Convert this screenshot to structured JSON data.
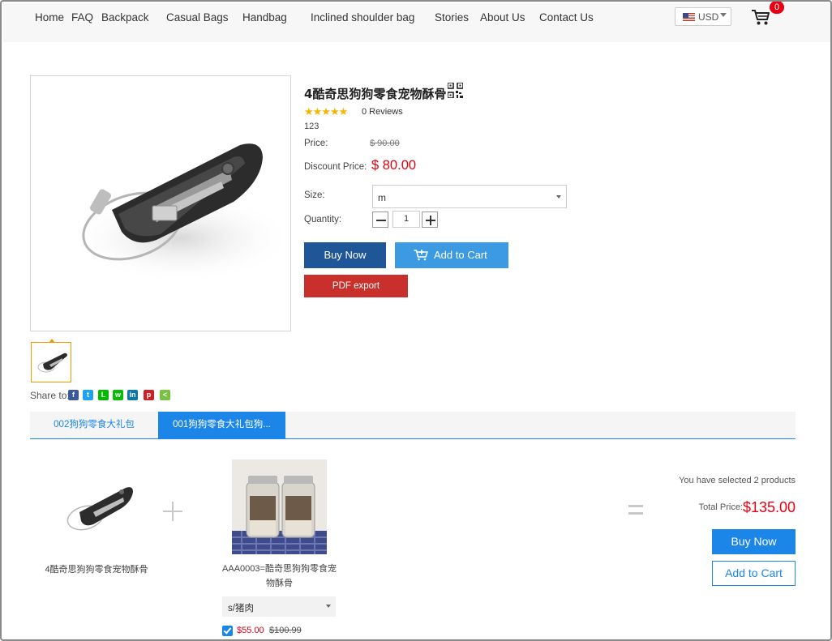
{
  "nav": {
    "items": [
      "Home",
      "FAQ",
      "Backpack",
      "Casual Bags",
      "Handbag",
      "Inclined shoulder bag",
      "Stories",
      "About Us",
      "Contact Us"
    ]
  },
  "currency": {
    "code": "USD",
    "flag": "us-flag-icon"
  },
  "cart": {
    "count": "0",
    "icon": "cart-icon"
  },
  "product": {
    "title": "4酷奇思狗狗零食宠物酥骨",
    "rating_stars": "★★★★★",
    "rating_value": 5,
    "reviews": "0 Reviews",
    "sku": "123",
    "price_label": "Price:",
    "price": "$ 90.00",
    "discount_label": "Discount Price:",
    "discount_price": "$ 80.00",
    "size_label": "Size:",
    "size_value": "m",
    "quantity_label": "Quantity:",
    "quantity": "1",
    "buy_now": "Buy Now",
    "add_to_cart": "Add to Cart",
    "pdf_export": "PDF export",
    "share_label": "Share to:",
    "share_icons": [
      "facebook-icon",
      "twitter-icon",
      "line-icon",
      "wechat-icon",
      "linkedin-icon",
      "pinterest-icon",
      "share-icon"
    ]
  },
  "tabs": [
    "002狗狗零食大礼包",
    "001狗狗零食大礼包狗..."
  ],
  "bundle": {
    "item1_name": "4酷奇思狗狗零食宠物酥骨",
    "item2_name": "AAA0003=酷奇思狗狗零食宠物酥骨",
    "item2_option": "s/猪肉",
    "item2_price": "$55.00",
    "item2_old_price": "$100.99",
    "selected_text": "You have selected  2  products",
    "total_label": "Total Price:",
    "total_value": "$135.00",
    "buy_now": "Buy Now",
    "add_to_cart": "Add to Cart"
  },
  "colors": {
    "accent": "#1b86e8",
    "buy_dark": "#1f5698",
    "cart_light": "#3b9ae1",
    "pdf_red": "#c9302c",
    "price_red": "#e60012",
    "star": "#f5b500"
  }
}
